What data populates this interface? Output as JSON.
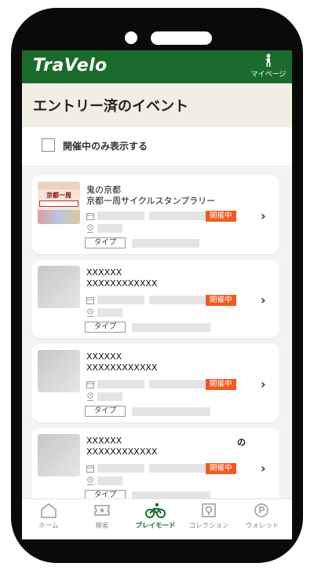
{
  "app": {
    "logo": "TraVelo",
    "mypage_label": "マイページ"
  },
  "page": {
    "title": "エントリー済のイベント"
  },
  "filter": {
    "label": "開催中のみ表示する",
    "checked": false
  },
  "events": [
    {
      "line1": "鬼の京都",
      "line2": "京都一周サイクルスタンプラリー",
      "extra": "",
      "status": "開催中",
      "type_label": "タイプ",
      "poster": {
        "title": "京都一周"
      }
    },
    {
      "line1": "XXXXXX",
      "line2": "XXXXXXXXXXXX",
      "extra": "",
      "status": "開催中",
      "type_label": "タイプ"
    },
    {
      "line1": "XXXXXX",
      "line2": "XXXXXXXXXXXX",
      "extra": "",
      "status": "開催中",
      "type_label": "タイプ"
    },
    {
      "line1": "XXXXXX",
      "line2": "XXXXXXXXXXXX",
      "extra": "の",
      "status": "開催中",
      "type_label": "タイプ"
    }
  ],
  "nav": [
    {
      "label": "ホーム",
      "icon": "home-icon",
      "active": false
    },
    {
      "label": "検索",
      "icon": "ticket-icon",
      "active": false
    },
    {
      "label": "プレイモード",
      "icon": "bicycle-icon",
      "active": true
    },
    {
      "label": "コレクション",
      "icon": "collection-icon",
      "active": false
    },
    {
      "label": "ウォレット",
      "icon": "wallet-icon",
      "active": false
    }
  ],
  "colors": {
    "brand": "#1b6b2c",
    "status_badge": "#ee5a20",
    "title_bg": "#f1efe4"
  }
}
